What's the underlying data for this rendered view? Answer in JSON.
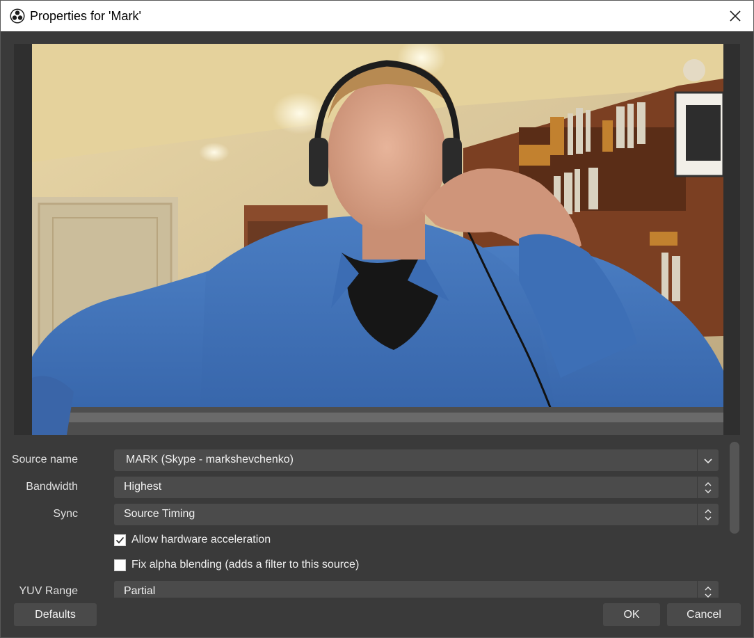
{
  "window": {
    "title": "Properties for 'Mark'",
    "app_icon": "obs-logo-icon",
    "close_icon": "close-icon"
  },
  "preview": {
    "description_icon": "skype-watermark-icon"
  },
  "properties": {
    "source_name": {
      "label": "Source name",
      "value": "MARK (Skype - markshevchenko)"
    },
    "bandwidth": {
      "label": "Bandwidth",
      "value": "Highest"
    },
    "sync": {
      "label": "Sync",
      "value": "Source Timing"
    },
    "hw_accel": {
      "label": "Allow hardware acceleration",
      "checked": true
    },
    "fix_alpha": {
      "label": "Fix alpha blending (adds a filter to this source)",
      "checked": false
    },
    "yuv_range": {
      "label": "YUV Range",
      "value": "Partial"
    }
  },
  "buttons": {
    "defaults": "Defaults",
    "ok": "OK",
    "cancel": "Cancel"
  },
  "colors": {
    "dialog_bg": "#3a3a3a",
    "field_bg": "#4b4b4b",
    "titlebar_bg": "#ffffff"
  }
}
